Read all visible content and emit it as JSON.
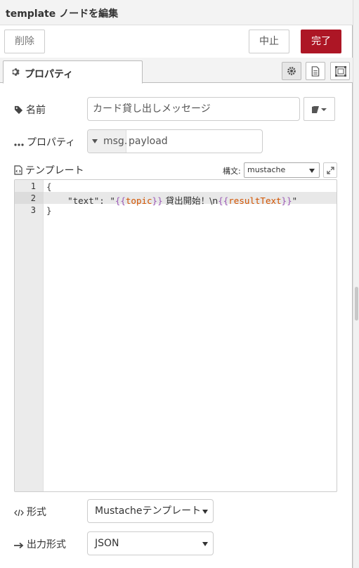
{
  "header": {
    "title": "template ノードを編集"
  },
  "toolbar": {
    "delete_label": "削除",
    "cancel_label": "中止",
    "done_label": "完了"
  },
  "tabs": {
    "properties_label": "プロパティ"
  },
  "form": {
    "name_label": "名前",
    "name_value": "カード貸し出しメッセージ",
    "property_label": "プロパティ",
    "property_type_prefix": "msg.",
    "property_value": "payload",
    "template_label": "テンプレート",
    "syntax_label": "構文:",
    "syntax_value": "mustache",
    "format_label": "形式",
    "format_value": "Mustacheテンプレート",
    "output_label": "出力形式",
    "output_value": "JSON"
  },
  "editor": {
    "line_numbers": [
      "1",
      "2",
      "3"
    ],
    "line1": "{",
    "line2": {
      "indent": "    ",
      "key": "\"text\"",
      "colon": ": \"",
      "open1": "{{",
      "var1": "topic",
      "close1": "}}",
      "text": " 貸出開始！\\n",
      "open2": "{{",
      "var2": "resultText",
      "close2": "}}",
      "end": "\""
    },
    "line3": "}"
  },
  "icons": {
    "tag": "tag-icon",
    "ellipsis": "ellipsis-icon",
    "file_code": "file-code-icon",
    "gear": "gear-icon",
    "book": "book-icon",
    "expand": "expand-icon",
    "code": "code-icon",
    "arrow_right": "arrow-right-icon"
  }
}
